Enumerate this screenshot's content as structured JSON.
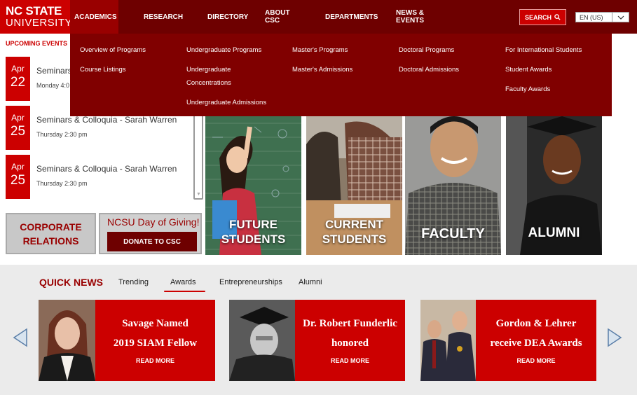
{
  "logo": {
    "line1": "NC STATE",
    "line2": "UNIVERSITY"
  },
  "nav": {
    "items": [
      {
        "label": "ACADEMICS",
        "active": true
      },
      {
        "label": "RESEARCH"
      },
      {
        "label": "DIRECTORY"
      },
      {
        "label": "ABOUT CSC"
      },
      {
        "label": "DEPARTMENTS"
      },
      {
        "label": "NEWS & EVENTS"
      }
    ],
    "search_label": "SEARCH",
    "language": "EN (US)"
  },
  "mega_menu": {
    "col1": [
      "Overview of Programs",
      "Course Listings"
    ],
    "col2": [
      "Undergraduate Programs",
      "Undergraduate Concentrations",
      "Undergraduate Admissions"
    ],
    "col3": [
      "Master's Programs",
      "Master's Admissions"
    ],
    "col4": [
      "Doctoral Programs",
      "Doctoral Admissions"
    ],
    "col5": [
      "For International Students",
      "Student Awards",
      "Faculty Awards"
    ]
  },
  "events": {
    "title": "UPCOMING EVENTS",
    "items": [
      {
        "month": "Apr",
        "day": "22",
        "title": "Seminars",
        "time": "Monday 4:0"
      },
      {
        "month": "Apr",
        "day": "25",
        "title": "Seminars & Colloquia - Sarah Warren",
        "time": "Thursday 2:30 pm"
      },
      {
        "month": "Apr",
        "day": "25",
        "title": "Seminars & Colloquia - Sarah Warren",
        "time": "Thursday 2:30 pm"
      }
    ]
  },
  "corporate": {
    "line1": "CORPORATE",
    "line2": "RELATIONS"
  },
  "giving": {
    "title": "NCSU Day of Giving!",
    "button": "DONATE TO CSC"
  },
  "tiles": {
    "future": {
      "line1": "FUTURE",
      "line2": "STUDENTS"
    },
    "current": {
      "line1": "CURRENT",
      "line2": "STUDENTS"
    },
    "faculty": {
      "label": "FACULTY"
    },
    "alumni": {
      "label": "ALUMNI"
    }
  },
  "quick_news": {
    "title": "QUICK NEWS",
    "tabs": [
      "Trending",
      "Awards",
      "Entrepreneurships",
      "Alumni"
    ],
    "active_tab": "Awards",
    "cards": [
      {
        "line1": "Savage Named",
        "line2": "2019 SIAM Fellow",
        "more": "READ MORE"
      },
      {
        "line1": "Dr. Robert Funderlic",
        "line2": "honored",
        "more": "READ MORE"
      },
      {
        "line1": "Gordon & Lehrer",
        "line2": "receive DEA Awards",
        "more": "READ MORE"
      }
    ]
  },
  "colors": {
    "brand_red": "#cc0000",
    "dark_red": "#6e0000",
    "menu_red": "#800000"
  }
}
